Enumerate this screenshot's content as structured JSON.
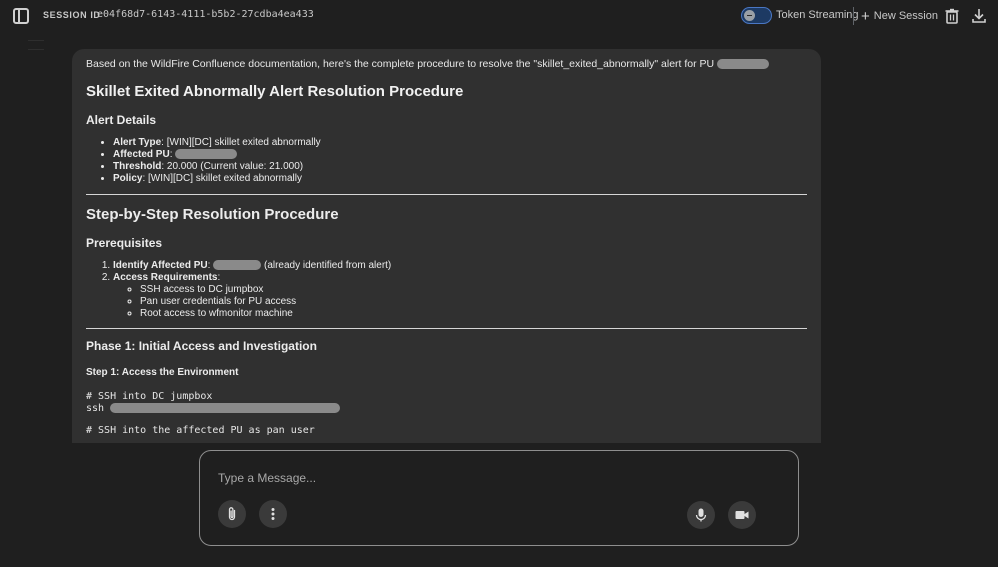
{
  "header": {
    "session_label": "SESSION ID",
    "session_id": "e04f68d7-6143-4111-b5b2-27cdba4ea433",
    "token_streaming_label": "Token Streaming",
    "new_session_label": "New Session",
    "icons": [
      "sidebar-toggle-icon",
      "plus-icon",
      "trash-icon",
      "download-icon"
    ]
  },
  "message": {
    "intro": "Based on the WildFire Confluence documentation, here's the complete procedure to resolve the \"skillet_exited_abnormally\" alert for PU",
    "title": "Skillet Exited Abnormally Alert Resolution Procedure",
    "alert_details_heading": "Alert Details",
    "alert_details": [
      {
        "label": "Alert Type",
        "value": ": [WIN][DC] skillet exited abnormally"
      },
      {
        "label": "Affected PU",
        "value": ":"
      },
      {
        "label": "Threshold",
        "value": ": 20.000 (Current value: 21.000)"
      },
      {
        "label": "Policy",
        "value": ": [WIN][DC] skillet exited abnormally"
      }
    ],
    "step_by_step_heading": "Step-by-Step Resolution Procedure",
    "prerequisites_heading": "Prerequisites",
    "prereq_1_label": "Identify Affected PU",
    "prereq_1_colon": ":",
    "prereq_1_suffix": "(already identified from alert)",
    "prereq_2_label": "Access Requirements",
    "prereq_2_colon": ":",
    "access_requirements": [
      "SSH access to DC jumpbox",
      "Pan user credentials for PU access",
      "Root access to wfmonitor machine"
    ],
    "phase_1_heading": "Phase 1: Initial Access and Investigation",
    "step_1_heading": "Step 1: Access the Environment",
    "code_comment_1": "# SSH into DC jumpbox",
    "code_cmd_1": "ssh",
    "code_comment_2": "# SSH into the affected PU as pan user"
  },
  "composer": {
    "placeholder": "Type a Message...",
    "icons": [
      "paperclip-icon",
      "more-vert-icon",
      "mic-icon",
      "video-icon"
    ]
  }
}
